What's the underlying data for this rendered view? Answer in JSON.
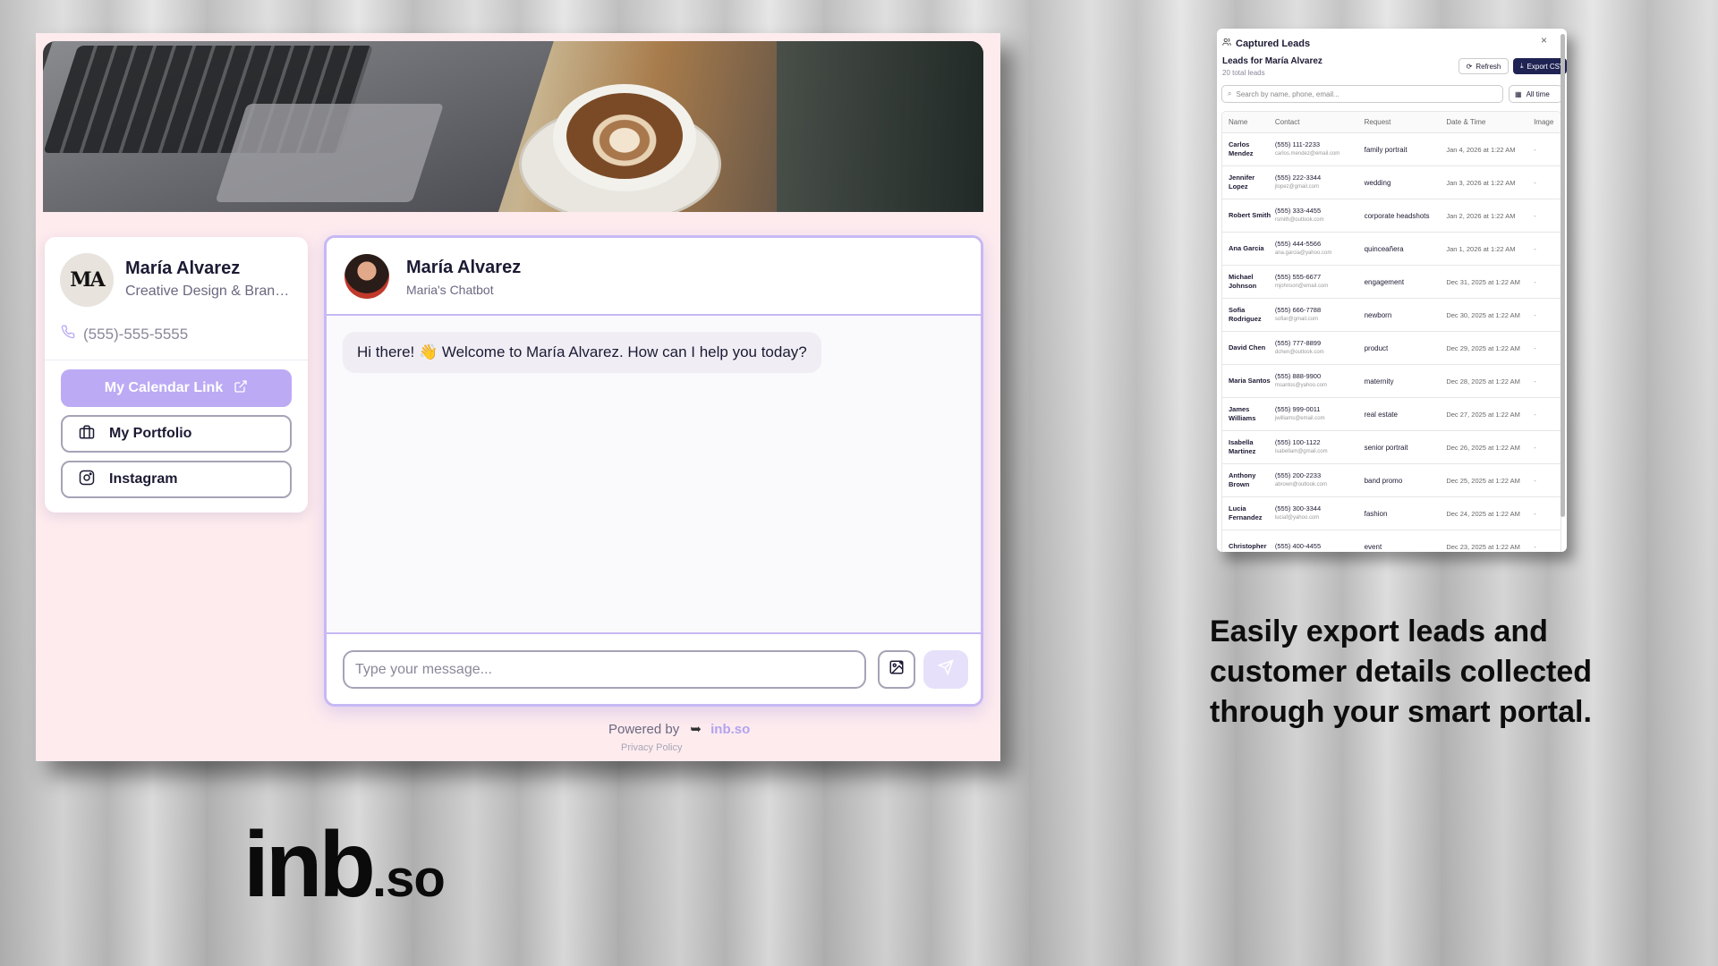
{
  "profile": {
    "initials": "MA",
    "name": "María Alvarez",
    "subtitle": "Creative Design & Branding",
    "phone": "(555)-555-5555",
    "buttons": {
      "calendar": "My Calendar Link",
      "portfolio": "My Portfolio",
      "instagram": "Instagram"
    }
  },
  "chat": {
    "name": "María Alvarez",
    "subtitle": "Maria's Chatbot",
    "welcome": "Hi there! 👋 Welcome to María Alvarez. How can I help you today?",
    "input_placeholder": "Type your message...",
    "powered_by": "Powered by",
    "brand": "inb.so",
    "privacy": "Privacy Policy"
  },
  "leads": {
    "title": "Captured Leads",
    "leads_for": "Leads for María Alvarez",
    "total": "20 total leads",
    "refresh": "Refresh",
    "export": "Export CSV",
    "search_placeholder": "Search by name, phone, email...",
    "range": "All time",
    "columns": [
      "Name",
      "Contact",
      "Request",
      "Date & Time",
      "Image"
    ],
    "rows": [
      {
        "name": "Carlos Mendez",
        "phone": "(555) 111-2233",
        "email": "carlos.mendez@email.com",
        "request": "family portrait",
        "date": "Jan 4, 2026 at 1:22 AM",
        "image": "-"
      },
      {
        "name": "Jennifer Lopez",
        "phone": "(555) 222-3344",
        "email": "jlopez@gmail.com",
        "request": "wedding",
        "date": "Jan 3, 2026 at 1:22 AM",
        "image": "-"
      },
      {
        "name": "Robert Smith",
        "phone": "(555) 333-4455",
        "email": "rsmith@outlook.com",
        "request": "corporate headshots",
        "date": "Jan 2, 2026 at 1:22 AM",
        "image": "-"
      },
      {
        "name": "Ana Garcia",
        "phone": "(555) 444-5566",
        "email": "ana.garcia@yahoo.com",
        "request": "quinceañera",
        "date": "Jan 1, 2026 at 1:22 AM",
        "image": "-"
      },
      {
        "name": "Michael Johnson",
        "phone": "(555) 555-6677",
        "email": "mjohnson@email.com",
        "request": "engagement",
        "date": "Dec 31, 2025 at 1:22 AM",
        "image": "-"
      },
      {
        "name": "Sofia Rodriguez",
        "phone": "(555) 666-7788",
        "email": "sofiar@gmail.com",
        "request": "newborn",
        "date": "Dec 30, 2025 at 1:22 AM",
        "image": "-"
      },
      {
        "name": "David Chen",
        "phone": "(555) 777-8899",
        "email": "dchen@outlook.com",
        "request": "product",
        "date": "Dec 29, 2025 at 1:22 AM",
        "image": "-"
      },
      {
        "name": "Maria Santos",
        "phone": "(555) 888-9900",
        "email": "msantos@yahoo.com",
        "request": "maternity",
        "date": "Dec 28, 2025 at 1:22 AM",
        "image": "-"
      },
      {
        "name": "James Williams",
        "phone": "(555) 999-0011",
        "email": "jwilliams@email.com",
        "request": "real estate",
        "date": "Dec 27, 2025 at 1:22 AM",
        "image": "-"
      },
      {
        "name": "Isabella Martinez",
        "phone": "(555) 100-1122",
        "email": "isabellam@gmail.com",
        "request": "senior portrait",
        "date": "Dec 26, 2025 at 1:22 AM",
        "image": "-"
      },
      {
        "name": "Anthony Brown",
        "phone": "(555) 200-2233",
        "email": "abrown@outlook.com",
        "request": "band promo",
        "date": "Dec 25, 2025 at 1:22 AM",
        "image": "-"
      },
      {
        "name": "Lucia Fernandez",
        "phone": "(555) 300-3344",
        "email": "luciaf@yahoo.com",
        "request": "fashion",
        "date": "Dec 24, 2025 at 1:22 AM",
        "image": "-"
      },
      {
        "name": "Christopher",
        "phone": "(555) 400-4455",
        "email": "",
        "request": "event",
        "date": "Dec 23, 2025 at 1:22 AM",
        "image": "-"
      }
    ]
  },
  "caption": "Easily export leads and customer details collected through your smart portal.",
  "logo": {
    "main": "inb",
    "suffix": ".so"
  },
  "colors": {
    "accent": "#bcaaf5",
    "border": "#c7b8f5",
    "portal_bg": "#fdebee",
    "export_btn": "#1f2353"
  }
}
